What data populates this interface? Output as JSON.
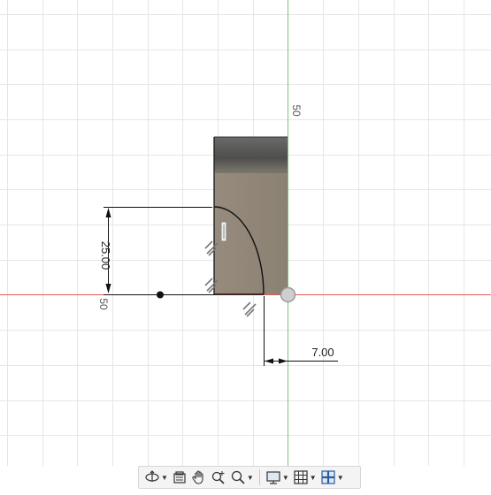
{
  "viewport": {
    "dimensions": {
      "width_value": "7.00",
      "height_value": "25.00"
    },
    "axis_labels": {
      "vertical_axis_value": "50",
      "horizontal_axis_value": "50"
    },
    "colors": {
      "x_axis": "#e25a5a",
      "y_axis": "#79c779",
      "body_fill": "#8f8577",
      "body_top": "#5e5e5c",
      "grid": "#e6e6e6"
    }
  },
  "toolbar": {
    "items": [
      {
        "icon": "orbit-icon",
        "dropdown": true
      },
      {
        "icon": "look-at-icon",
        "dropdown": false
      },
      {
        "icon": "pan-hand-icon",
        "dropdown": false
      },
      {
        "icon": "zoom-icon",
        "dropdown": false
      },
      {
        "icon": "fit-zoom-icon",
        "dropdown": true
      },
      {
        "icon": "display-settings-icon",
        "dropdown": true
      },
      {
        "icon": "grid-settings-icon",
        "dropdown": true
      },
      {
        "icon": "viewports-icon",
        "dropdown": true
      }
    ]
  }
}
